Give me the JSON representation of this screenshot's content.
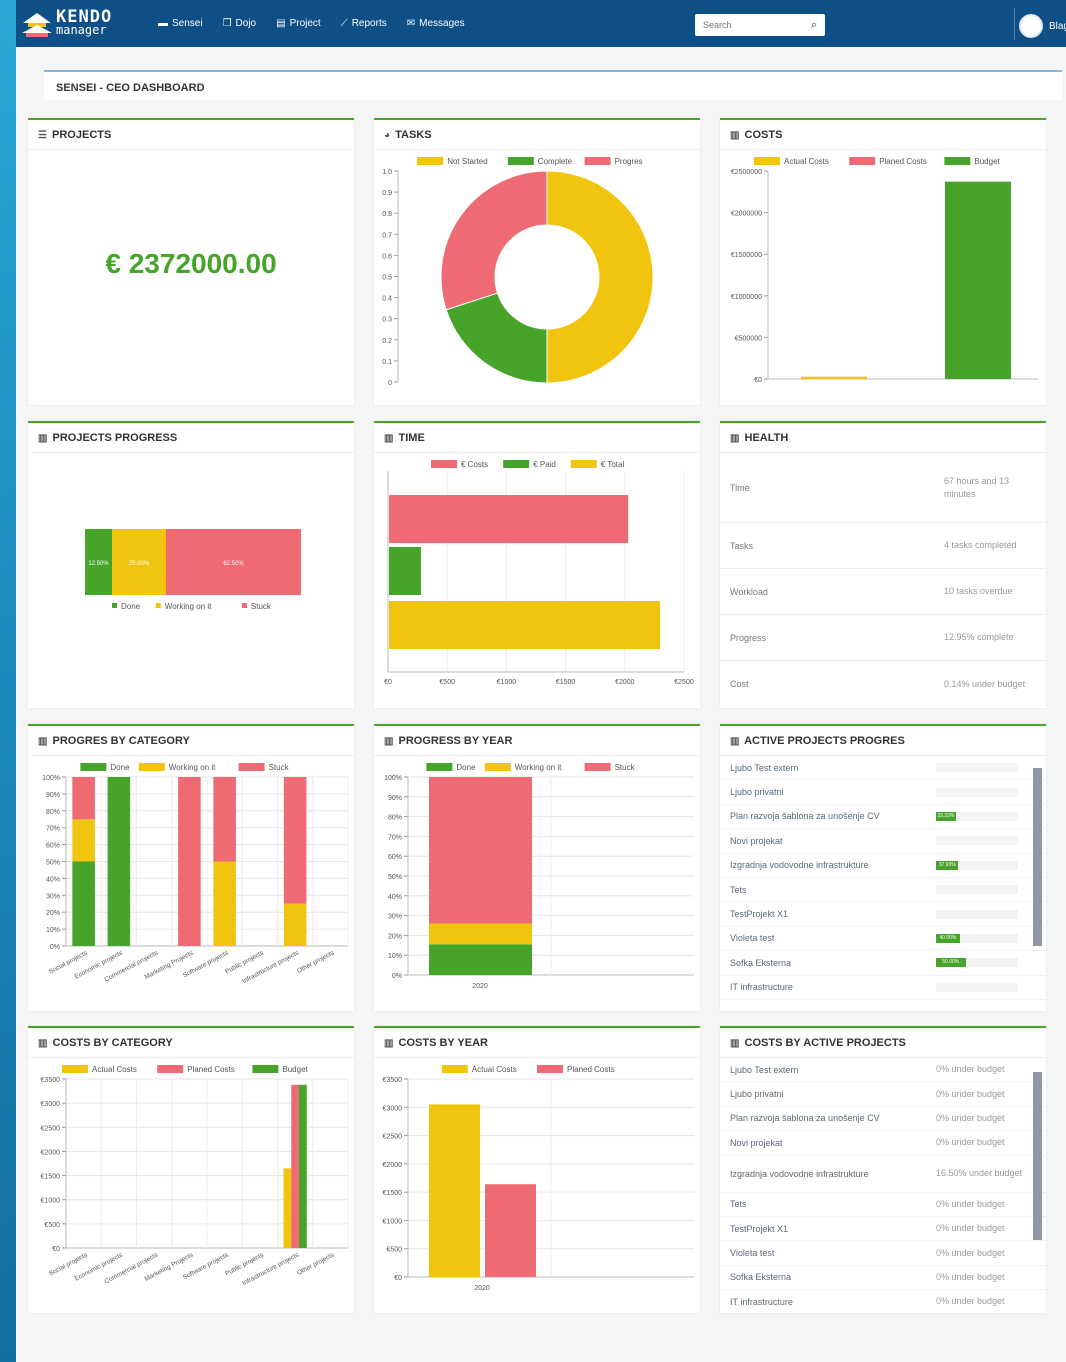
{
  "header": {
    "logo_top": "KENDO",
    "logo_bottom": "manager",
    "nav": [
      {
        "label": "Sensei",
        "icon": "briefcase-icon"
      },
      {
        "label": "Dojo",
        "icon": "copy-icon"
      },
      {
        "label": "Project",
        "icon": "file-icon"
      },
      {
        "label": "Reports",
        "icon": "line-chart-icon"
      },
      {
        "label": "Messages",
        "icon": "envelope-icon"
      }
    ],
    "search_placeholder": "Search",
    "user": "Blaga"
  },
  "page_title": "SENSEI - CEO DASHBOARD",
  "panels": {
    "projects": "PROJECTS",
    "tasks": "TASKS",
    "costs": "COSTS",
    "projects_progress": "PROJECTS PROGRESS",
    "time": "TIME",
    "health": "HEALTH",
    "progres_by_category": "PROGRES BY CATEGORY",
    "progress_by_year": "PROGRESS BY YEAR",
    "active_projects_progres": "ACTIVE PROJECTS PROGRES",
    "costs_by_category": "COSTS BY CATEGORY",
    "costs_by_year": "COSTS BY YEAR",
    "costs_by_active_projects": "COSTS BY ACTIVE PROJECTS"
  },
  "projects_total": "€ 2372000.00",
  "colors": {
    "yellow": "#f0c40f",
    "green": "#46a42a",
    "red": "#ee6b74"
  },
  "health": [
    {
      "label": "Time",
      "value": "67 hours and 13 minutes"
    },
    {
      "label": "Tasks",
      "value": "4 tasks completed"
    },
    {
      "label": "Workload",
      "value": "10 tasks overdue"
    },
    {
      "label": "Progress",
      "value": "12.95% complete"
    },
    {
      "label": "Cost",
      "value": "0.14% under budget"
    }
  ],
  "active_projects": [
    {
      "name": "Ljubo Test extern",
      "pct": 0,
      "label": ""
    },
    {
      "name": "Ljubo privatni",
      "pct": 0,
      "label": ""
    },
    {
      "name": "Plan razvoja šablona za unošenje CV",
      "pct": 33.33,
      "label": "33.33%"
    },
    {
      "name": "Novi projekat",
      "pct": 0,
      "label": ""
    },
    {
      "name": "Izgradnja vodovodne infrastrukture",
      "pct": 37.93,
      "label": "37.93%"
    },
    {
      "name": "Tets",
      "pct": 0,
      "label": ""
    },
    {
      "name": "TestProjekt X1",
      "pct": 0,
      "label": ""
    },
    {
      "name": "Violeta test",
      "pct": 40,
      "label": "40.00%"
    },
    {
      "name": "Sofka Eksterna",
      "pct": 50,
      "label": "50.00%"
    },
    {
      "name": "IT infrastructure",
      "pct": 0,
      "label": ""
    }
  ],
  "active_costs": [
    {
      "name": "Ljubo Test extern",
      "value": "0% under budget"
    },
    {
      "name": "Ljubo privatni",
      "value": "0% under budget"
    },
    {
      "name": "Plan razvoja šablona za unošenje CV",
      "value": "0% under budget"
    },
    {
      "name": "Novi projekat",
      "value": "0% under budget"
    },
    {
      "name": "Izgradnja vodovodne infrastrukture",
      "value": "16.50% under budget"
    },
    {
      "name": "Tets",
      "value": "0% under budget"
    },
    {
      "name": "TestProjekt X1",
      "value": "0% under budget"
    },
    {
      "name": "Violeta test",
      "value": "0% under budget"
    },
    {
      "name": "Sofka Eksterna",
      "value": "0% under budget"
    },
    {
      "name": "IT infrastructure",
      "value": "0% under budget"
    }
  ],
  "chart_data": [
    {
      "id": "tasks",
      "type": "pie",
      "legend": [
        "Not Started",
        "Complete",
        "Progres"
      ],
      "values": [
        50,
        20,
        30
      ],
      "ylim": [
        0,
        1
      ],
      "yticks": [
        "0",
        "0.1",
        "0.2",
        "0.3",
        "0.4",
        "0.5",
        "0.6",
        "0.7",
        "0.8",
        "0.9",
        "1.0"
      ]
    },
    {
      "id": "costs",
      "type": "bar",
      "legend": [
        "Actual Costs",
        "Planed Costs",
        "Budget"
      ],
      "series": [
        {
          "name": "Actual Costs",
          "values": [
            28000
          ]
        },
        {
          "name": "Budget",
          "values": [
            2372000
          ]
        }
      ],
      "ylim": [
        0,
        2500000
      ],
      "yticks": [
        "€0",
        "€500000",
        "€1000000",
        "€1500000",
        "€2000000",
        "€2500000"
      ]
    },
    {
      "id": "projects_progress",
      "type": "bar",
      "series": [
        {
          "name": "Done",
          "values": [
            12.5
          ],
          "label": "12.50%"
        },
        {
          "name": "Working on it",
          "values": [
            25
          ],
          "label": "25.00%"
        },
        {
          "name": "Stuck",
          "values": [
            62.5
          ],
          "label": "62.50%"
        }
      ]
    },
    {
      "id": "time",
      "type": "bar",
      "legend": [
        "€ Costs",
        "€ Paid",
        "€ Total"
      ],
      "values": [
        2020,
        270,
        2290
      ],
      "xlim": [
        0,
        2500
      ],
      "xticks": [
        "€0",
        "€500",
        "€1000",
        "€1500",
        "€2000",
        "€2500"
      ]
    },
    {
      "id": "progres_by_category",
      "type": "bar",
      "legend": [
        "Done",
        "Working on it",
        "Stuck"
      ],
      "categories": [
        "Social projects",
        "Economic projects",
        "Commercial projects",
        "Marketing Projects",
        "Software projects",
        "Public projects",
        "Infrastructure projects",
        "Other projects"
      ],
      "series": [
        {
          "name": "Done",
          "values": [
            50,
            100,
            0,
            0,
            0,
            0,
            0,
            0
          ]
        },
        {
          "name": "Working on it",
          "values": [
            25,
            0,
            0,
            0,
            50,
            0,
            25,
            0
          ]
        },
        {
          "name": "Stuck",
          "values": [
            25,
            0,
            0,
            100,
            50,
            0,
            75,
            0
          ]
        }
      ],
      "ylim": [
        0,
        100
      ],
      "yticks": [
        "0%",
        "10%",
        "20%",
        "30%",
        "40%",
        "50%",
        "60%",
        "70%",
        "80%",
        "90%",
        "100%"
      ]
    },
    {
      "id": "progress_by_year",
      "type": "bar",
      "legend": [
        "Done",
        "Working on it",
        "Stuck"
      ],
      "categories": [
        "2020"
      ],
      "series": [
        {
          "name": "Done",
          "values": [
            15.5
          ]
        },
        {
          "name": "Working on it",
          "values": [
            10.5
          ]
        },
        {
          "name": "Stuck",
          "values": [
            74
          ]
        }
      ],
      "ylim": [
        0,
        100
      ],
      "yticks": [
        "0%",
        "10%",
        "20%",
        "30%",
        "40%",
        "50%",
        "60%",
        "70%",
        "80%",
        "90%",
        "100%"
      ]
    },
    {
      "id": "costs_by_category",
      "type": "bar",
      "legend": [
        "Actual Costs",
        "Planed Costs",
        "Budget"
      ],
      "categories": [
        "Social projects",
        "Economic projects",
        "Commercial projects",
        "Marketing Projects",
        "Software projects",
        "Public projects",
        "Infrastructure projects",
        "Other projects"
      ],
      "series": [
        {
          "name": "Actual Costs",
          "values": [
            0,
            0,
            0,
            0,
            0,
            0,
            1650,
            0
          ]
        },
        {
          "name": "Planed Costs",
          "values": [
            0,
            0,
            0,
            0,
            0,
            0,
            3380,
            0
          ]
        },
        {
          "name": "Budget",
          "values": [
            0,
            0,
            0,
            0,
            0,
            0,
            3380,
            0
          ]
        }
      ],
      "ylim": [
        0,
        3500
      ],
      "yticks": [
        "€0",
        "€500",
        "€1000",
        "€1500",
        "€2000",
        "€2500",
        "€3000",
        "€3500"
      ]
    },
    {
      "id": "costs_by_year",
      "type": "bar",
      "legend": [
        "Actual Costs",
        "Planed Costs"
      ],
      "categories": [
        "2020"
      ],
      "series": [
        {
          "name": "Actual Costs",
          "values": [
            3050
          ]
        },
        {
          "name": "Planed Costs",
          "values": [
            1640
          ]
        }
      ],
      "ylim": [
        0,
        3500
      ],
      "yticks": [
        "€0",
        "€500",
        "€1000",
        "€1500",
        "€2000",
        "€2500",
        "€3000",
        "€3500"
      ]
    }
  ]
}
